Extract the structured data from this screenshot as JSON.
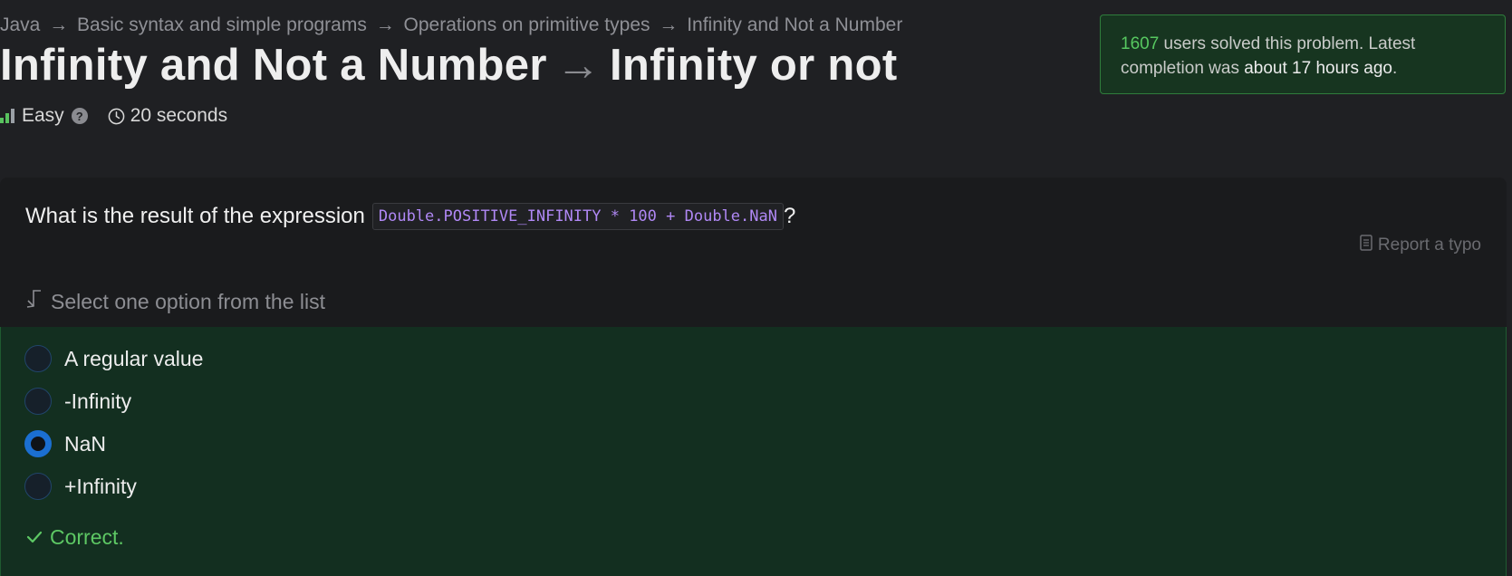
{
  "breadcrumb": {
    "items": [
      "Java",
      "Basic syntax and simple programs",
      "Operations on primitive types",
      "Infinity and Not a Number"
    ],
    "separator": "→"
  },
  "title": {
    "topic": "Infinity and Not a Number",
    "arrow": "→",
    "problem": "Infinity or not"
  },
  "meta": {
    "difficulty": "Easy",
    "help_glyph": "?",
    "duration": "20 seconds"
  },
  "solved_box": {
    "count": "1607",
    "text_mid": " users solved this problem. Latest completion was ",
    "time": "about 17 hours ago",
    "text_end": "."
  },
  "question": {
    "text": "What is the result of the expression",
    "code": "Double.POSITIVE_INFINITY * 100 + Double.NaN",
    "suffix": "?"
  },
  "report_link": "Report a typo",
  "select_hint": "Select one option from the list",
  "options": [
    {
      "label": "A regular value",
      "checked": false
    },
    {
      "label": "-Infinity",
      "checked": false
    },
    {
      "label": "NaN",
      "checked": true
    },
    {
      "label": "+Infinity",
      "checked": false
    }
  ],
  "feedback": "Correct.",
  "colors": {
    "accent_green": "#57c860",
    "code_purple": "#b088f5",
    "radio_blue": "#1b6fd1",
    "success_bg": "#132f20"
  },
  "icons": [
    "difficulty-bars-icon",
    "help-icon",
    "clock-icon",
    "document-icon",
    "return-arrow-icon",
    "checkmark-icon"
  ]
}
